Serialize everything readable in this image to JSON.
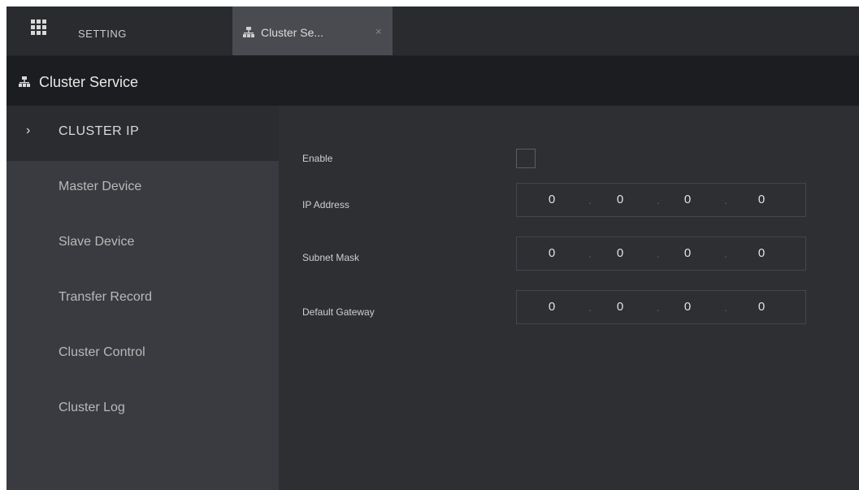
{
  "tabs": {
    "setting_label": "SETTING",
    "active_tab_label": "Cluster Se...",
    "close_symbol": "×"
  },
  "header": {
    "title": "Cluster Service"
  },
  "sidebar": {
    "items": [
      {
        "label": "CLUSTER IP",
        "active": true
      },
      {
        "label": "Master Device",
        "active": false
      },
      {
        "label": "Slave Device",
        "active": false
      },
      {
        "label": "Transfer Record",
        "active": false
      },
      {
        "label": "Cluster Control",
        "active": false
      },
      {
        "label": "Cluster Log",
        "active": false
      }
    ],
    "active_indicator": "›"
  },
  "form": {
    "enable": {
      "label": "Enable",
      "checked": false
    },
    "ip_address": {
      "label": "IP Address",
      "octets": [
        "0",
        "0",
        "0",
        "0"
      ]
    },
    "subnet_mask": {
      "label": "Subnet Mask",
      "octets": [
        "0",
        "0",
        "0",
        "0"
      ]
    },
    "default_gateway": {
      "label": "Default Gateway",
      "octets": [
        "0",
        "0",
        "0",
        "0"
      ]
    }
  },
  "icons": {
    "menu": "grid-menu-icon",
    "cluster": "cluster-network-icon"
  },
  "colors": {
    "background": "#2e2f33",
    "header": "#1c1d20",
    "sidebar": "#3a3b40",
    "active_tab": "#4a4b50"
  }
}
